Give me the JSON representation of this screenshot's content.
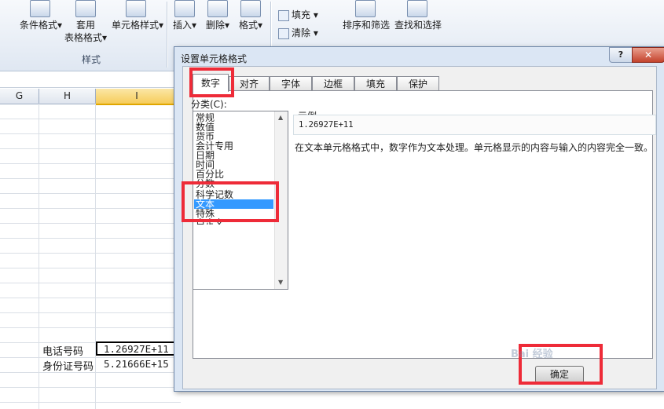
{
  "ribbon": {
    "conditional_format": "条件格式",
    "table_format_line1": "套用",
    "table_format_line2": "表格格式",
    "cell_style": "单元格样式",
    "styles_group": "样式",
    "insert": "插入",
    "delete": "删除",
    "format": "格式",
    "fill": "填充",
    "clear": "清除",
    "sort_filter": "排序和筛选",
    "find_select": "查找和选择",
    "dropdown_arrow": "▾"
  },
  "grid": {
    "columns": [
      "G",
      "H",
      "I"
    ],
    "rows": [
      {
        "label": "电话号码",
        "value": "1.26927E+11"
      },
      {
        "label": "身份证号码",
        "value": "5.21666E+15"
      }
    ]
  },
  "dialog": {
    "title": "设置单元格格式",
    "help": "?",
    "close": "✕",
    "tabs": [
      "数字",
      "对齐",
      "字体",
      "边框",
      "填充",
      "保护"
    ],
    "category_label": "分类(C):",
    "categories": [
      "常规",
      "数值",
      "货币",
      "会计专用",
      "日期",
      "时间",
      "百分比",
      "分数",
      "科学记数",
      "文本",
      "特殊",
      "自定义"
    ],
    "selected_category": "文本",
    "sample_label": "示例",
    "sample_value": "1.26927E+11",
    "description": "在文本单元格格式中，数字作为文本处理。单元格显示的内容与输入的内容完全一致。",
    "ok_button": "确定"
  },
  "watermark": "Bai 经验",
  "colors": {
    "highlight": "#ee2b38",
    "selection": "#3399ff",
    "dialog_frame": "#dbe6f4"
  }
}
